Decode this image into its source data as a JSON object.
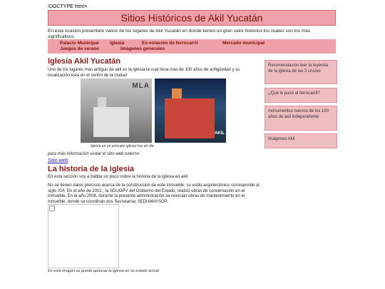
{
  "stray_text": "!DOCTYPE html>",
  "header": {
    "title": "Sitios Históricos de Akil Yucatán"
  },
  "intro": "En esta ocasión presentare varios de los lugares de Akil Yucatán en donde tienen un gran valor histórico los cuales son los más significativos",
  "nav": {
    "items": [
      "Palacio Municipal",
      "Iglesia",
      "Ex-estación de ferrocarril",
      "Mercado municipal",
      "Juegos de verano",
      "Imágenes generales"
    ]
  },
  "main": {
    "section1": {
      "heading": "Iglesia Akil Yucatán",
      "paragraph": "Uno de los lugares más antiguo de akil es la iglesia la cual lleva mas de 100 años de antigüedad y su localización esta en el centro de la ciudad",
      "photo1_logo": "MLA",
      "photo2_tag": "AKIL",
      "caption": "Iglesia en un principio iglesia hoy en dia",
      "more_info": "para más información visitar el sitio web externo",
      "link": "Sitio web"
    },
    "section2": {
      "heading": "La historia de la iglesia",
      "paragraph1": "En esta sección voy a hablar un poco sobre la historia de la iglesia en akil",
      "paragraph2": "No se tienen datos precisos acerca de la construcción de este inmueble; su estilo arquitectónico corresponde al siglo XVI. En el año de 2002 , la SDUOPV del Gobierno del Estado, realizó obras de conservación en el inmueble. En el año 2008, durante la presente administración se reinician obras de mantenimiento en el inmueble, donde se coordinan dos Secretarías SEDUMAYSOP.",
      "caption": "En esta imagen se puede apreciar la iglesia en su estado actual"
    }
  },
  "sidebar": {
    "items": [
      "Recomendación leer la leyenda de la iglesia de las 3 cruces",
      "¿Qué le pasó al ferrocarril?",
      "monumentos nuevos de los 100 años de akil independiente",
      "Imágenes Akil"
    ]
  },
  "colors": {
    "accent": "#f0a0a8",
    "heading": "#8a1a1a",
    "link": "#1a1aa6",
    "sidebar_bg": "#efbcc0"
  }
}
